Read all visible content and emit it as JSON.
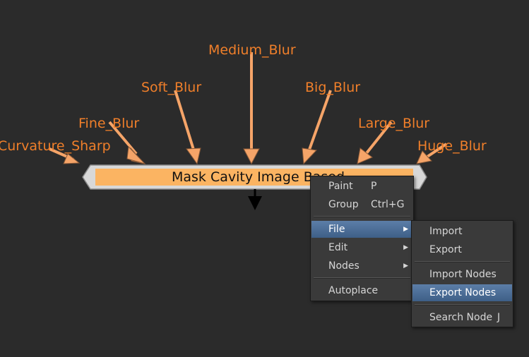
{
  "node": {
    "title": "Mask Cavity Image Based",
    "inputs": [
      "Curvature_Sharp",
      "Fine_Blur",
      "Soft_Blur",
      "Medium_Blur",
      "Big_Blur",
      "Large_Blur",
      "Huge_Blur"
    ]
  },
  "context_menu": {
    "items": [
      {
        "label": "Paint",
        "shortcut": "P"
      },
      {
        "label": "Group",
        "shortcut": "Ctrl+G"
      },
      {
        "label": "File",
        "submenu": true
      },
      {
        "label": "Edit",
        "submenu": true
      },
      {
        "label": "Nodes",
        "submenu": true
      },
      {
        "label": "Autoplace"
      }
    ]
  },
  "file_submenu": {
    "items": [
      {
        "label": "Import"
      },
      {
        "label": "Export"
      },
      {
        "label": "Import Nodes"
      },
      {
        "label": "Export Nodes"
      },
      {
        "label": "Search Node",
        "shortcut": "J"
      }
    ]
  },
  "colors": {
    "background": "#2b2b2b",
    "accent_orange": "#f07f2a",
    "arrow_fill": "#f5a468",
    "node_fill": "#fbb462",
    "menu_highlight": "#4a6c95"
  }
}
